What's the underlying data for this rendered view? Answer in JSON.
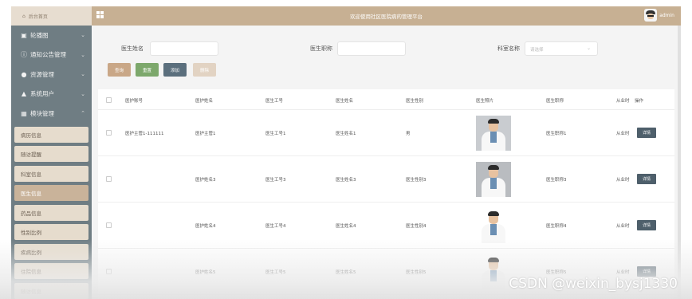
{
  "sidebar": {
    "home": "后台首页",
    "menus": [
      {
        "icon": "carousel-icon",
        "glyph": "▣",
        "label": "轮播图"
      },
      {
        "icon": "info-icon",
        "glyph": "ⓘ",
        "label": "通知公告管理"
      },
      {
        "icon": "resource-icon",
        "glyph": "●",
        "label": "资源管理"
      },
      {
        "icon": "user-icon",
        "glyph": "▲",
        "label": "系统用户"
      },
      {
        "icon": "module-icon",
        "glyph": "▦",
        "label": "模块管理"
      }
    ],
    "submenu": [
      "病历信息",
      "随访提醒",
      "科室信息",
      "医生信息",
      "药品信息",
      "性别比例",
      "疾病比例",
      "住院信息",
      "随访信息"
    ],
    "active_index": 3
  },
  "header": {
    "title": "欢迎使用社区医院病的管理平台",
    "username": "admin"
  },
  "search": {
    "label1": "医生姓名",
    "label2": "医生职称",
    "label3": "科室名称",
    "select_placeholder": "请选择"
  },
  "buttons": {
    "query": {
      "label": "查询",
      "color": "#c9a787"
    },
    "reset": {
      "label": "重置",
      "color": "#7da86c"
    },
    "add": {
      "label": "添加",
      "color": "#5b6f7d"
    },
    "delete": {
      "label": "删除",
      "color": "#e2d3c3"
    }
  },
  "table": {
    "headers": [
      "医护账号",
      "医护姓名",
      "医生工号",
      "医生姓名",
      "医生性别",
      "医生照片",
      "医生职称",
      "从业时",
      "操作"
    ],
    "rows": [
      {
        "account": "医护主管1-111111",
        "name": "医护主管1",
        "no": "医生工号1",
        "doctor": "医生姓名1",
        "gender": "男",
        "photo": "doctor-photo-1",
        "title": "医生职称1",
        "years": "从业时",
        "action": "详情"
      },
      {
        "account": "",
        "name": "医护姓名3",
        "no": "医生工号3",
        "doctor": "医生姓名3",
        "gender": "医生性别3",
        "photo": "doctor-photo-3",
        "title": "医生职称3",
        "years": "从业时",
        "action": "详情"
      },
      {
        "account": "",
        "name": "医护姓名4",
        "no": "医生工号4",
        "doctor": "医生姓名4",
        "gender": "医生性别4",
        "photo": "doctor-photo-4",
        "title": "医生职称4",
        "years": "从业时",
        "action": "详情"
      },
      {
        "account": "",
        "name": "医护姓名5",
        "no": "医生工号5",
        "doctor": "医生姓名5",
        "gender": "医生性别5",
        "photo": "doctor-photo-5",
        "title": "医生职称5",
        "years": "从业时",
        "action": "详情"
      }
    ]
  },
  "watermark": "CSDN @weixin_bysj1330"
}
